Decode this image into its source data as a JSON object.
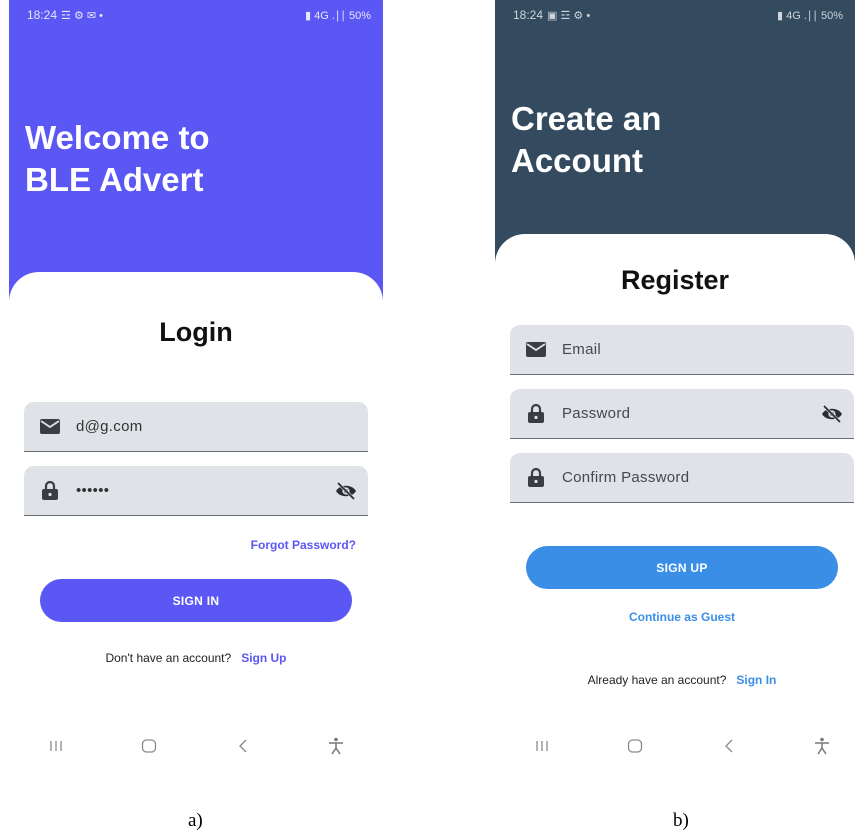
{
  "screen_a": {
    "status": {
      "time": "18:24",
      "left_icons": "☲ ⚙ ✉ •",
      "right_text": "▮ 4G .∣∣ 50%"
    },
    "heading": "Welcome to\nBLE Advert",
    "form_title": "Login",
    "email_value": "d@g.com",
    "password_value": "••••••",
    "forgot_label": "Forgot Password?",
    "signin_label": "SIGN IN",
    "no_account_text": "Don't have an account?",
    "signup_link": "Sign Up",
    "colors": {
      "header": "#5b57f5",
      "accent": "#5b57f5"
    }
  },
  "screen_b": {
    "status": {
      "time": "18:24",
      "left_icons": "▣ ☲ ⚙ •",
      "right_text": "▮ 4G .∣∣ 50%"
    },
    "heading": "Create an\nAccount",
    "form_title": "Register",
    "email_placeholder": "Email",
    "password_placeholder": "Password",
    "confirm_placeholder": "Confirm Password",
    "signup_label": "SIGN UP",
    "guest_label": "Continue as Guest",
    "have_account_text": "Already have an account?",
    "signin_link": "Sign In",
    "colors": {
      "header": "#344a5e",
      "accent": "#3b8ee6"
    }
  },
  "nav_icons": [
    "recent-apps-icon",
    "home-icon",
    "back-icon",
    "accessibility-icon"
  ],
  "captions": {
    "a": "a)",
    "b": "b)"
  }
}
